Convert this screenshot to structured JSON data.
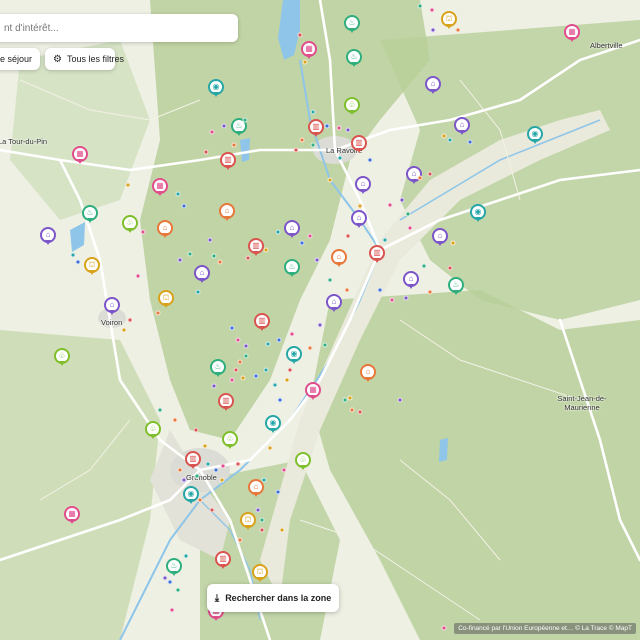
{
  "search": {
    "placeholder": "nt d'intérêt..."
  },
  "filters": {
    "chip1_label": "es de séjour",
    "all_filters_label": "Tous les filtres",
    "all_filters_icon": "sliders-icon"
  },
  "search_zone_button": {
    "label": "Rechercher dans la zone",
    "icon": "search-area-icon"
  },
  "attribution": "Co-financé par l'Union Européenne et… © La Trace © MapT",
  "places": [
    "Albertville",
    "La Tour-du-Pin",
    "La Ravoire",
    "Voiron",
    "Saint-Jean-de-Maurienne",
    "Grenoble"
  ],
  "colors": {
    "map_bg": "#eef0e4",
    "forest": "#b8cf9a",
    "water": "#8ec5e8",
    "road": "#ffffff",
    "urban": "#dcdcd6",
    "pin_pink": "#e04d8c",
    "pin_purple": "#7c55c9",
    "pin_green": "#2fae7d",
    "pin_orange": "#e8773a",
    "pin_red": "#d9534f",
    "pin_yellow": "#d9a21b",
    "pin_lime": "#7fbf2b",
    "pin_teal": "#26a6a6"
  }
}
